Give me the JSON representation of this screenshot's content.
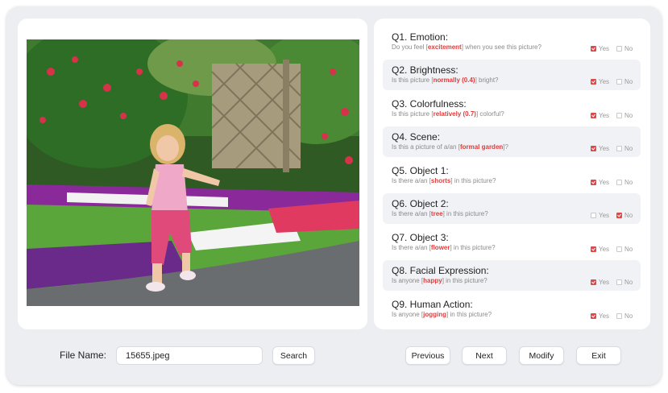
{
  "questions": [
    {
      "title": "Q1. Emotion:",
      "pre": "Do you feel [",
      "kw": "excitement",
      "post": "] when you see this picture?",
      "yes": true,
      "no": false
    },
    {
      "title": "Q2. Brightness:",
      "pre": "Is this picture [",
      "kw": "normally (0.4)",
      "post": "] bright?",
      "yes": true,
      "no": false
    },
    {
      "title": "Q3. Colorfulness:",
      "pre": "Is this picture [",
      "kw": "relatively (0.7)",
      "post": "] colorful?",
      "yes": true,
      "no": false
    },
    {
      "title": "Q4. Scene:",
      "pre": "Is this a picture of a/an [",
      "kw": "formal garden",
      "post": "]?",
      "yes": true,
      "no": false
    },
    {
      "title": "Q5. Object 1:",
      "pre": "Is there a/an [",
      "kw": "shorts",
      "post": "] in this picture?",
      "yes": true,
      "no": false
    },
    {
      "title": "Q6. Object 2:",
      "pre": "Is there a/an [",
      "kw": "tree",
      "post": "] in this picture?",
      "yes": false,
      "no": true
    },
    {
      "title": "Q7. Object 3:",
      "pre": "Is there a/an [",
      "kw": "flower",
      "post": "] in this picture?",
      "yes": true,
      "no": false
    },
    {
      "title": "Q8. Facial Expression:",
      "pre": "Is anyone [",
      "kw": "happy",
      "post": "] in this picture?",
      "yes": true,
      "no": false
    },
    {
      "title": "Q9. Human Action:",
      "pre": "Is anyone [",
      "kw": "jogging",
      "post": "] in this picture?",
      "yes": true,
      "no": false
    }
  ],
  "options": {
    "yes": "Yes",
    "no": "No"
  },
  "file": {
    "label": "File Name:",
    "value": "15655.jpeg"
  },
  "buttons": {
    "search": "Search",
    "previous": "Previous",
    "next": "Next",
    "modify": "Modify",
    "exit": "Exit"
  },
  "colors": {
    "accent": "#e04848",
    "keyword": "#e03c3c",
    "frame": "#eceef2"
  }
}
